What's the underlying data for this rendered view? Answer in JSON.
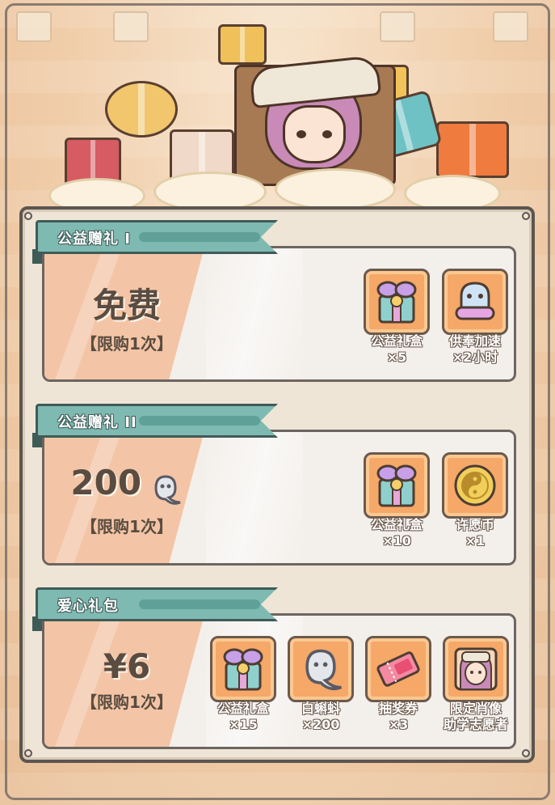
{
  "colors": {
    "ribbon": "#7fbab2",
    "tile": "#f5a868",
    "price_stripe": "#f3c5a6",
    "panel": "#efe5d6"
  },
  "packs": [
    {
      "title": "公益赠礼 I",
      "price": "免费",
      "price_icon": null,
      "limit": "【限购1次】",
      "items": [
        {
          "icon": "charity-gift-box-icon",
          "name": "公益礼盒",
          "count": "×5"
        },
        {
          "icon": "ghost-offering-speedup-icon",
          "name": "供奉加速",
          "count": "×2小时"
        }
      ]
    },
    {
      "title": "公益赠礼 II",
      "price": "200",
      "price_icon": "white-tadpole-icon",
      "limit": "【限购1次】",
      "items": [
        {
          "icon": "charity-gift-box-icon",
          "name": "公益礼盒",
          "count": "×10"
        },
        {
          "icon": "wish-coin-icon",
          "name": "许愿币",
          "count": "×1"
        }
      ]
    },
    {
      "title": "爱心礼包",
      "price": "¥6",
      "price_icon": null,
      "limit": "【限购1次】",
      "items": [
        {
          "icon": "charity-gift-box-icon",
          "name": "公益礼盒",
          "count": "×15"
        },
        {
          "icon": "white-tadpole-icon",
          "name": "白蝌蚪",
          "count": "×200"
        },
        {
          "icon": "lottery-ticket-icon",
          "name": "抽奖券",
          "count": "×3"
        },
        {
          "icon": "portrait-icon",
          "name": "限定肖像",
          "count": "助学志愿者"
        }
      ]
    }
  ]
}
